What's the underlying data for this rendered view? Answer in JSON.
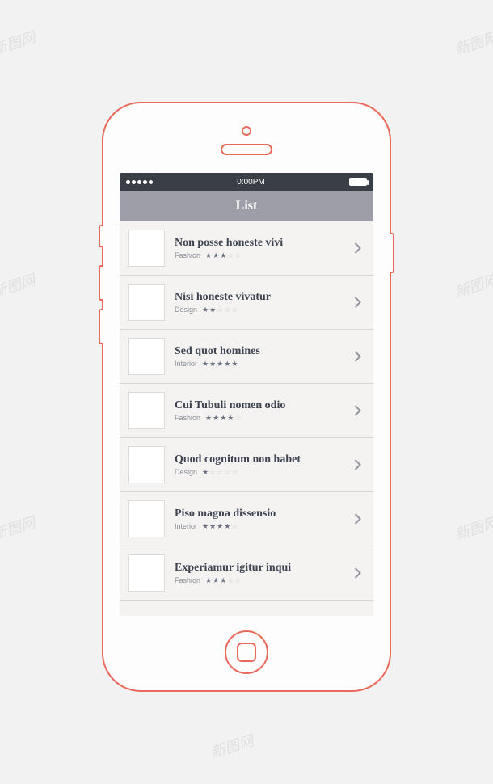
{
  "watermark_text": "新图网",
  "status": {
    "time": "0:00PM"
  },
  "nav": {
    "title": "List"
  },
  "max_stars": 5,
  "items": [
    {
      "title": "Non posse honeste vivi",
      "category": "Fashion",
      "rating": 3
    },
    {
      "title": "Nisi honeste vivatur",
      "category": "Design",
      "rating": 2
    },
    {
      "title": "Sed quot homines",
      "category": "Interior",
      "rating": 5
    },
    {
      "title": "Cui Tubuli nomen odio",
      "category": "Fashion",
      "rating": 4
    },
    {
      "title": "Quod cognitum non habet",
      "category": "Design",
      "rating": 1
    },
    {
      "title": "Piso magna dissensio",
      "category": "Interior",
      "rating": 4
    },
    {
      "title": "Experiamur igitur inqui",
      "category": "Fashion",
      "rating": 3
    }
  ]
}
